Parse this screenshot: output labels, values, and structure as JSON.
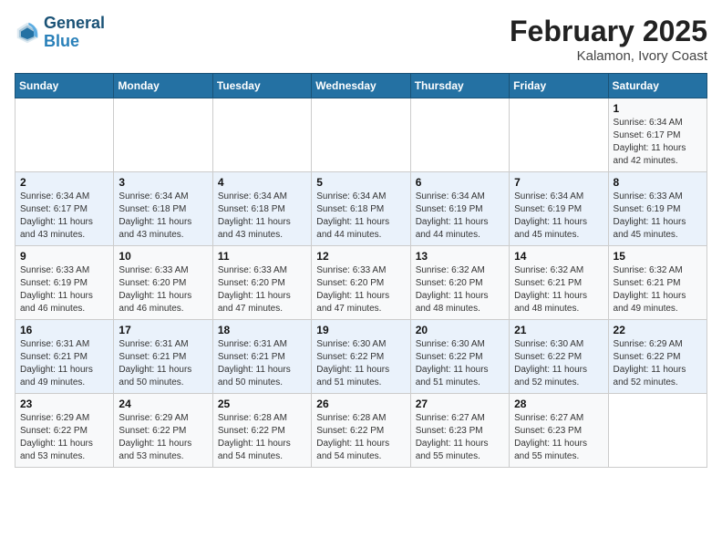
{
  "header": {
    "logo_line1": "General",
    "logo_line2": "Blue",
    "month_title": "February 2025",
    "location": "Kalamon, Ivory Coast"
  },
  "weekdays": [
    "Sunday",
    "Monday",
    "Tuesday",
    "Wednesday",
    "Thursday",
    "Friday",
    "Saturday"
  ],
  "weeks": [
    [
      {
        "day": "",
        "info": ""
      },
      {
        "day": "",
        "info": ""
      },
      {
        "day": "",
        "info": ""
      },
      {
        "day": "",
        "info": ""
      },
      {
        "day": "",
        "info": ""
      },
      {
        "day": "",
        "info": ""
      },
      {
        "day": "1",
        "info": "Sunrise: 6:34 AM\nSunset: 6:17 PM\nDaylight: 11 hours\nand 42 minutes."
      }
    ],
    [
      {
        "day": "2",
        "info": "Sunrise: 6:34 AM\nSunset: 6:17 PM\nDaylight: 11 hours\nand 43 minutes."
      },
      {
        "day": "3",
        "info": "Sunrise: 6:34 AM\nSunset: 6:18 PM\nDaylight: 11 hours\nand 43 minutes."
      },
      {
        "day": "4",
        "info": "Sunrise: 6:34 AM\nSunset: 6:18 PM\nDaylight: 11 hours\nand 43 minutes."
      },
      {
        "day": "5",
        "info": "Sunrise: 6:34 AM\nSunset: 6:18 PM\nDaylight: 11 hours\nand 44 minutes."
      },
      {
        "day": "6",
        "info": "Sunrise: 6:34 AM\nSunset: 6:19 PM\nDaylight: 11 hours\nand 44 minutes."
      },
      {
        "day": "7",
        "info": "Sunrise: 6:34 AM\nSunset: 6:19 PM\nDaylight: 11 hours\nand 45 minutes."
      },
      {
        "day": "8",
        "info": "Sunrise: 6:33 AM\nSunset: 6:19 PM\nDaylight: 11 hours\nand 45 minutes."
      }
    ],
    [
      {
        "day": "9",
        "info": "Sunrise: 6:33 AM\nSunset: 6:19 PM\nDaylight: 11 hours\nand 46 minutes."
      },
      {
        "day": "10",
        "info": "Sunrise: 6:33 AM\nSunset: 6:20 PM\nDaylight: 11 hours\nand 46 minutes."
      },
      {
        "day": "11",
        "info": "Sunrise: 6:33 AM\nSunset: 6:20 PM\nDaylight: 11 hours\nand 47 minutes."
      },
      {
        "day": "12",
        "info": "Sunrise: 6:33 AM\nSunset: 6:20 PM\nDaylight: 11 hours\nand 47 minutes."
      },
      {
        "day": "13",
        "info": "Sunrise: 6:32 AM\nSunset: 6:20 PM\nDaylight: 11 hours\nand 48 minutes."
      },
      {
        "day": "14",
        "info": "Sunrise: 6:32 AM\nSunset: 6:21 PM\nDaylight: 11 hours\nand 48 minutes."
      },
      {
        "day": "15",
        "info": "Sunrise: 6:32 AM\nSunset: 6:21 PM\nDaylight: 11 hours\nand 49 minutes."
      }
    ],
    [
      {
        "day": "16",
        "info": "Sunrise: 6:31 AM\nSunset: 6:21 PM\nDaylight: 11 hours\nand 49 minutes."
      },
      {
        "day": "17",
        "info": "Sunrise: 6:31 AM\nSunset: 6:21 PM\nDaylight: 11 hours\nand 50 minutes."
      },
      {
        "day": "18",
        "info": "Sunrise: 6:31 AM\nSunset: 6:21 PM\nDaylight: 11 hours\nand 50 minutes."
      },
      {
        "day": "19",
        "info": "Sunrise: 6:30 AM\nSunset: 6:22 PM\nDaylight: 11 hours\nand 51 minutes."
      },
      {
        "day": "20",
        "info": "Sunrise: 6:30 AM\nSunset: 6:22 PM\nDaylight: 11 hours\nand 51 minutes."
      },
      {
        "day": "21",
        "info": "Sunrise: 6:30 AM\nSunset: 6:22 PM\nDaylight: 11 hours\nand 52 minutes."
      },
      {
        "day": "22",
        "info": "Sunrise: 6:29 AM\nSunset: 6:22 PM\nDaylight: 11 hours\nand 52 minutes."
      }
    ],
    [
      {
        "day": "23",
        "info": "Sunrise: 6:29 AM\nSunset: 6:22 PM\nDaylight: 11 hours\nand 53 minutes."
      },
      {
        "day": "24",
        "info": "Sunrise: 6:29 AM\nSunset: 6:22 PM\nDaylight: 11 hours\nand 53 minutes."
      },
      {
        "day": "25",
        "info": "Sunrise: 6:28 AM\nSunset: 6:22 PM\nDaylight: 11 hours\nand 54 minutes."
      },
      {
        "day": "26",
        "info": "Sunrise: 6:28 AM\nSunset: 6:22 PM\nDaylight: 11 hours\nand 54 minutes."
      },
      {
        "day": "27",
        "info": "Sunrise: 6:27 AM\nSunset: 6:23 PM\nDaylight: 11 hours\nand 55 minutes."
      },
      {
        "day": "28",
        "info": "Sunrise: 6:27 AM\nSunset: 6:23 PM\nDaylight: 11 hours\nand 55 minutes."
      },
      {
        "day": "",
        "info": ""
      }
    ]
  ]
}
